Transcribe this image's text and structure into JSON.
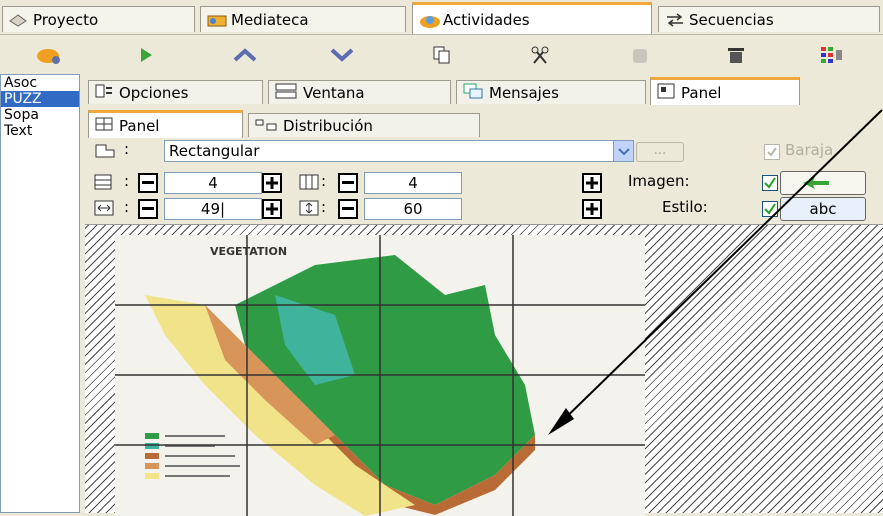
{
  "top_tabs": [
    {
      "label": "Proyecto",
      "icon": "project-icon"
    },
    {
      "label": "Mediateca",
      "icon": "media-icon"
    },
    {
      "label": "Actividades",
      "icon": "activities-icon",
      "active": true
    },
    {
      "label": "Secuencias",
      "icon": "sequences-icon"
    }
  ],
  "toolbar": {
    "icons": [
      "new-activity-icon",
      "play-icon",
      "move-up-icon",
      "move-down-icon",
      "copy-icon",
      "cut-icon",
      "paste-icon",
      "delete-icon",
      "grid-icon"
    ]
  },
  "left_list": {
    "items": [
      "Asoc",
      "PUZZ",
      "Sopa",
      "Text"
    ],
    "selected_index": 1
  },
  "panel_tabs": [
    {
      "label": "Opciones",
      "icon": "options-icon"
    },
    {
      "label": "Ventana",
      "icon": "window-icon"
    },
    {
      "label": "Mensajes",
      "icon": "messages-icon"
    },
    {
      "label": "Panel",
      "icon": "panel-icon",
      "active": true
    }
  ],
  "inner_tabs": [
    {
      "label": "Panel",
      "icon": "grid-panel-icon",
      "active": true
    },
    {
      "label": "Distribución",
      "icon": "distribution-icon"
    }
  ],
  "shape": {
    "selected": "Rectangular",
    "dots_label": "...",
    "shuffle_label": "Baraja"
  },
  "rows": {
    "value": "4"
  },
  "cols": {
    "value": "4"
  },
  "width": {
    "value": "49|"
  },
  "height": {
    "value": "60"
  },
  "image": {
    "label": "Imagen:",
    "checked": true
  },
  "style": {
    "label": "Estilo:",
    "checked": true,
    "button_label": "abc"
  },
  "map": {
    "title": "VEGETATION"
  },
  "colors": {
    "accent_tab": "#f2a93b",
    "selection": "#316ac5",
    "map_green": "#2f9b45",
    "map_teal": "#3fb39b",
    "map_brown": "#b86b35",
    "map_yellow": "#f1e38a"
  }
}
